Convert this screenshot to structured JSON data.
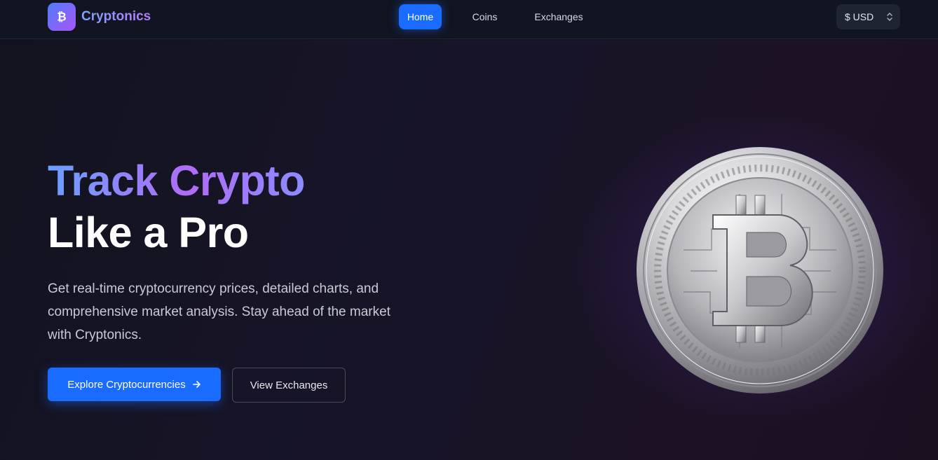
{
  "brand": {
    "name": "Cryptonics",
    "logo_icon": "bitcoin-icon"
  },
  "nav": {
    "items": [
      {
        "label": "Home",
        "active": true
      },
      {
        "label": "Coins",
        "active": false
      },
      {
        "label": "Exchanges",
        "active": false
      }
    ]
  },
  "currency": {
    "selected": "$ USD",
    "icon": "chevron-up-down-icon"
  },
  "hero": {
    "title_gradient": "Track Crypto",
    "title_plain": "Like a Pro",
    "description": "Get real-time cryptocurrency prices, detailed charts, and comprehensive market analysis. Stay ahead of the market with Cryptonics.",
    "primary_button": "Explore Cryptocurrencies",
    "primary_button_icon": "arrow-right-icon",
    "secondary_button": "View Exchanges",
    "image": "bitcoin-coin-image"
  },
  "colors": {
    "accent": "#1a6bff",
    "background": "#12111f",
    "brand_gradient_start": "#4f7cf7",
    "brand_gradient_end": "#a855f7"
  }
}
